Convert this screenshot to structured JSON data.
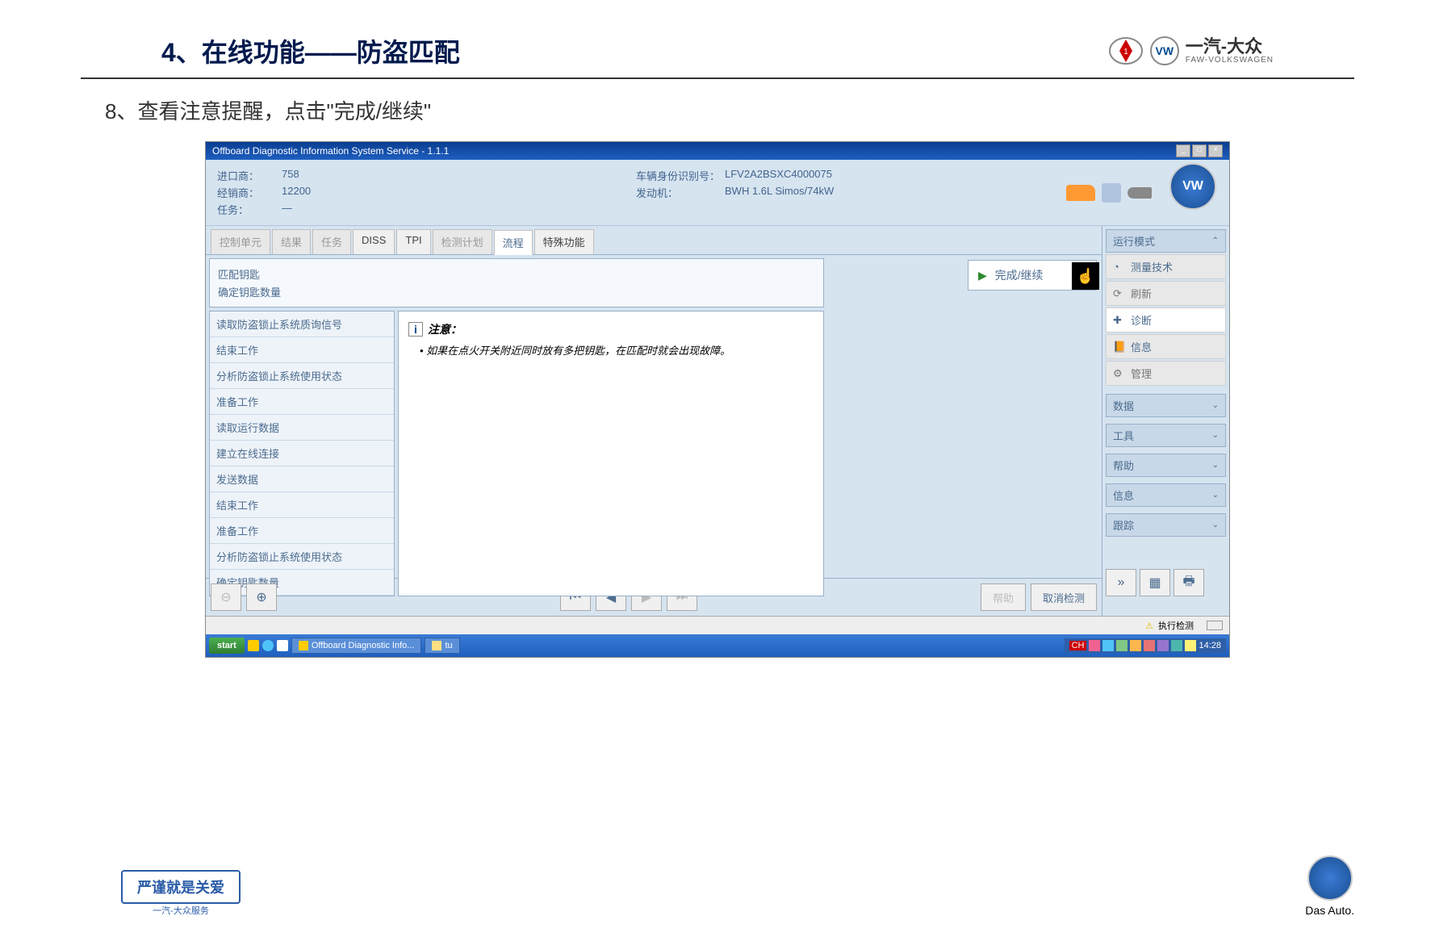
{
  "slide": {
    "title": "4、在线功能——防盗匹配",
    "step_text": "8、查看注意提醒，点击\"完成/继续\"",
    "brand_cn": "一汽-大众",
    "brand_en": "FAW-VOLKSWAGEN",
    "slogan": "严谨就是关爱",
    "slogan_sub": "一汽-大众服务",
    "das_auto": "Das Auto."
  },
  "window": {
    "title": "Offboard Diagnostic Information System Service - 1.1.1",
    "info": {
      "importer_label": "进口商：",
      "importer_value": "758",
      "dealer_label": "经销商：",
      "dealer_value": "12200",
      "order_label": "任务：",
      "order_value": "—",
      "vin_label": "车辆身份识别号：",
      "vin_value": "LFV2A2BSXC4000075",
      "engine_label": "发动机：",
      "engine_value": "BWH 1.6L Simos/74kW"
    },
    "tabs": [
      "控制单元",
      "结果",
      "任务",
      "DISS",
      "TPI",
      "检测计划",
      "流程",
      "特殊功能"
    ],
    "active_tab": "流程",
    "breadcrumb": {
      "line1": "匹配钥匙",
      "line2": "确定钥匙数量"
    },
    "steps": [
      "读取防盗锁止系统质询信号",
      "结束工作",
      "分析防盗锁止系统使用状态",
      "准备工作",
      "读取运行数据",
      "建立在线连接",
      "发送数据",
      "结束工作",
      "准备工作",
      "分析防盗锁止系统使用状态",
      "确定钥匙数量"
    ],
    "note_title": "注意：",
    "note_body": "• 如果在点火开关附近同时放有多把钥匙，在匹配时就会出现故障。",
    "complete_btn": "完成/继续",
    "help_btn": "帮助",
    "cancel_btn": "取消检测",
    "status_text": "执行检测"
  },
  "sidebar": {
    "mode_header": "运行模式",
    "mode_items": [
      {
        "icon": "gauge",
        "label": "测量技术",
        "enabled": true
      },
      {
        "icon": "refresh",
        "label": "刷新",
        "enabled": false
      },
      {
        "icon": "diag",
        "label": "诊断",
        "enabled": true,
        "active": true
      },
      {
        "icon": "info",
        "label": "信息",
        "enabled": true
      },
      {
        "icon": "admin",
        "label": "管理",
        "enabled": false
      }
    ],
    "sections": [
      "数据",
      "工具",
      "帮助",
      "信息",
      "跟踪"
    ]
  },
  "taskbar": {
    "start": "start",
    "items": [
      "Offboard Diagnostic Info...",
      "tu"
    ],
    "lang": "CH",
    "time": "14:28"
  }
}
